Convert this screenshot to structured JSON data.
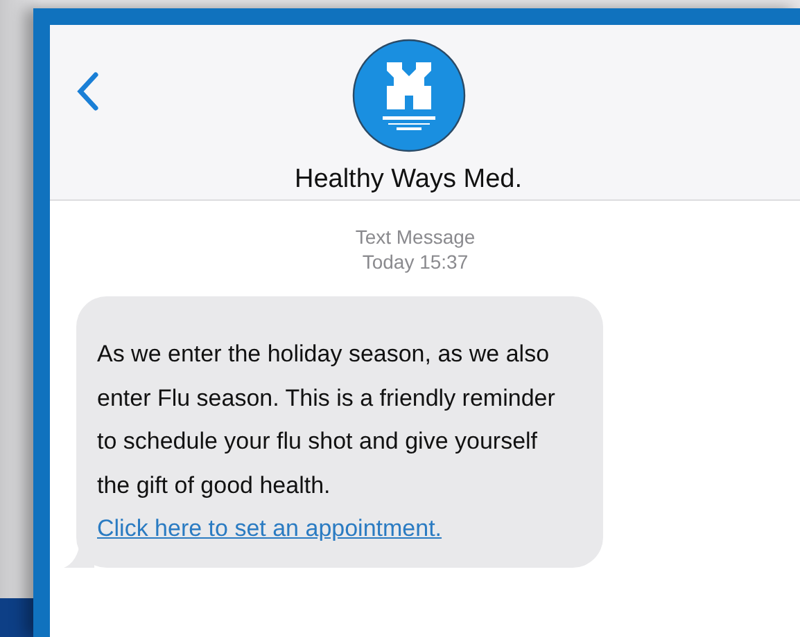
{
  "contact": {
    "name": "Healthy Ways Med."
  },
  "thread": {
    "label": "Text Message",
    "timestamp": "Today 15:37"
  },
  "messages": [
    {
      "text": "As we enter the holiday season, as we also enter Flu season. This is a friendly reminder to schedule your flu shot and give yourself the gift of good health.",
      "link": "Click here to set an appointment."
    }
  ]
}
